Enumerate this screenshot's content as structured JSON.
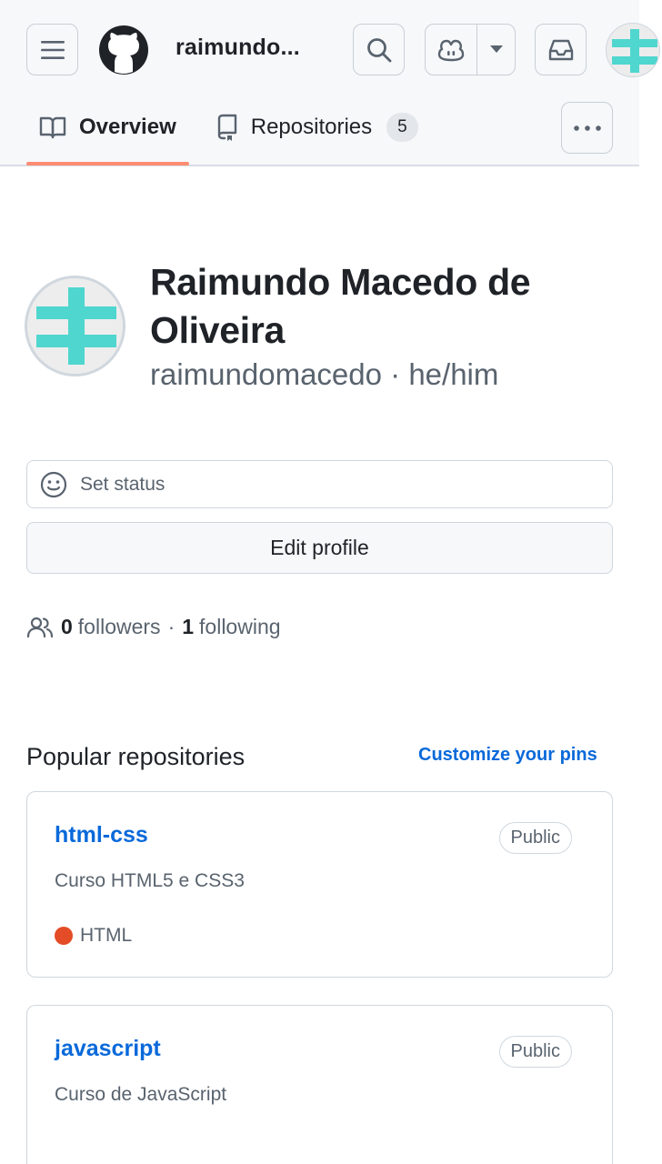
{
  "header": {
    "username": "raimundo...",
    "tabs": [
      {
        "label": "Overview",
        "icon": "book-icon",
        "active": true
      },
      {
        "label": "Repositories",
        "icon": "repo-icon",
        "count": "5",
        "active": false
      }
    ]
  },
  "profile": {
    "full_name": "Raimundo Macedo de Oliveira",
    "username": "raimundomacedo",
    "separator": "·",
    "pronouns": "he/him",
    "set_status_label": "Set status",
    "edit_profile_label": "Edit profile",
    "followers_count": "0",
    "followers_label": "followers",
    "following_count": "1",
    "following_label": "following"
  },
  "popular": {
    "title": "Popular repositories",
    "customize_label": "Customize your pins",
    "repos": [
      {
        "name": "html-css",
        "visibility": "Public",
        "description": "Curso HTML5 e CSS3",
        "language": "HTML",
        "language_color": "#e34c26"
      },
      {
        "name": "javascript",
        "visibility": "Public",
        "description": "Curso de JavaScript"
      }
    ]
  },
  "colors": {
    "accent_link": "#0969da",
    "tab_underline": "#fd8c73",
    "identicon": "#4fd6cf"
  }
}
